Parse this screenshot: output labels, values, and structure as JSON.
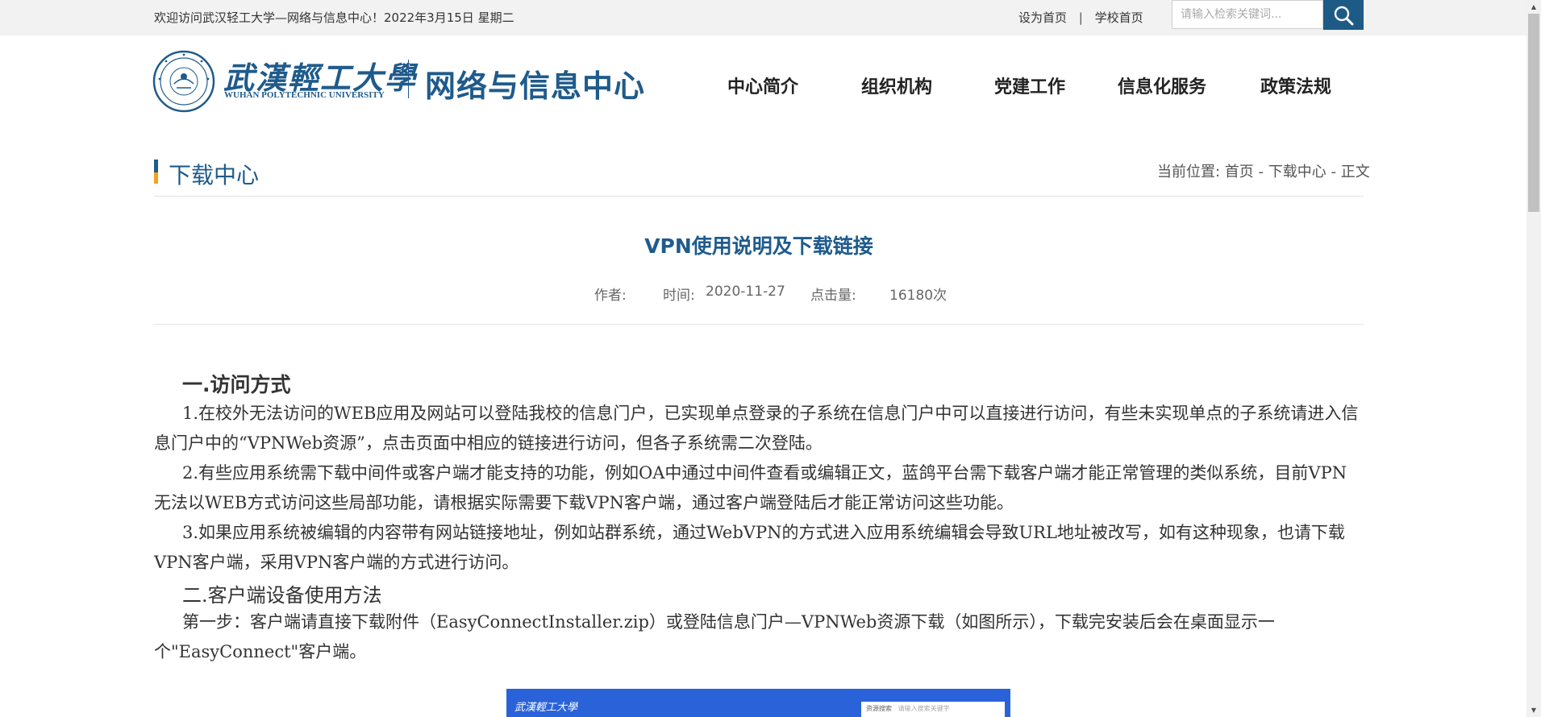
{
  "topbar": {
    "welcome": "欢迎访问武汉轻工大学—网络与信息中心！2022年3月15日  星期二",
    "set_home": "设为首页",
    "separator": "|",
    "school_home": "学校首页",
    "search_placeholder": "请输入检索关键词...",
    "search_icon": "search-icon"
  },
  "header": {
    "logo_cn": "武漢輕工大學",
    "logo_en": "WUHAN POLYTECHNIC UNIVERSITY",
    "center_name": "网络与信息中心",
    "nav": [
      "中心简介",
      "组织机构",
      "党建工作",
      "信息化服务",
      "政策法规"
    ]
  },
  "section": {
    "title": "下载中心",
    "breadcrumb_label": "当前位置: ",
    "breadcrumb_home": "首页",
    "breadcrumb_sep1": " - ",
    "breadcrumb_section": "下载中心",
    "breadcrumb_sep2": " - ",
    "breadcrumb_current": "正文"
  },
  "article": {
    "title": "VPN使用说明及下载链接",
    "author_label": "作者:",
    "time_label": "时间:",
    "time_value": "2020-11-27",
    "clicks_label": "点击量:",
    "clicks_value": "16180次",
    "h1": "一.访问方式",
    "p1": "1.在校外无法访问的WEB应用及网站可以登陆我校的信息门户，已实现单点登录的子系统在信息门户中可以直接进行访问，有些未实现单点的子系统请进入信息门户中的“VPNWeb资源”，点击页面中相应的链接进行访问，但各子系统需二次登陆。",
    "p2": "2.有些应用系统需下载中间件或客户端才能支持的功能，例如OA中通过中间件查看或编辑正文，蓝鸽平台需下载客户端才能正常管理的类似系统，目前VPN无法以WEB方式访问这些局部功能，请根据实际需要下载VPN客户端，通过客户端登陆后才能正常访问这些功能。",
    "p3": "3.如果应用系统被编辑的内容带有网站链接地址，例如站群系统，通过WebVPN的方式进入应用系统编辑会导致URL地址被改写，如有这种现象，也请下载VPN客户端，采用VPN客户端的方式进行访问。",
    "h2": "二.客户端设备使用方法",
    "p4": "第一步：客户端请直接下载附件（EasyConnectInstaller.zip）或登陆信息门户—VPNWeb资源下载（如图所示），下载完安装后会在桌面显示一个\"EasyConnect\"客户端。"
  },
  "figure": {
    "logo": "武漢輕工大學",
    "search_label": "资源搜索",
    "search_hint": "请输入搜索关键字"
  },
  "colors": {
    "brand_blue": "#1f5b8c",
    "accent_orange": "#f0a21b",
    "search_button": "#1e5a86"
  }
}
